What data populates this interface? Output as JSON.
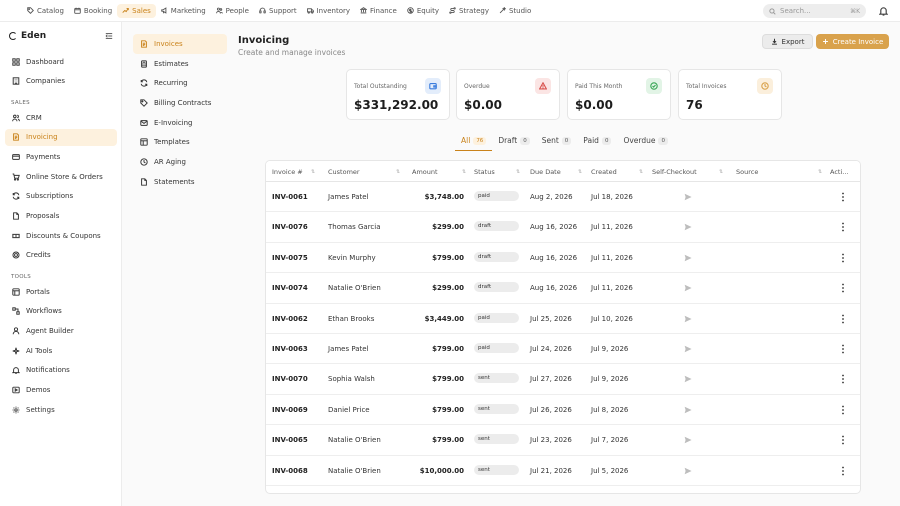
{
  "topnav": {
    "items": [
      {
        "label": "Catalog",
        "icon": "tag-icon"
      },
      {
        "label": "Booking",
        "icon": "calendar-icon"
      },
      {
        "label": "Sales",
        "icon": "trend-icon",
        "active": true
      },
      {
        "label": "Marketing",
        "icon": "megaphone-icon"
      },
      {
        "label": "People",
        "icon": "people-icon"
      },
      {
        "label": "Support",
        "icon": "headset-icon"
      },
      {
        "label": "Inventory",
        "icon": "truck-icon"
      },
      {
        "label": "Finance",
        "icon": "bank-icon"
      },
      {
        "label": "Equity",
        "icon": "dollar-circle-icon"
      },
      {
        "label": "Strategy",
        "icon": "route-icon"
      },
      {
        "label": "Studio",
        "icon": "wand-icon"
      }
    ],
    "search_placeholder": "Search...",
    "search_shortcut": "⌘K"
  },
  "sidebar": {
    "brand": "Eden",
    "items_top": [
      {
        "label": "Dashboard",
        "icon": "grid-icon"
      },
      {
        "label": "Companies",
        "icon": "building-icon"
      }
    ],
    "section_sales": "SALES",
    "items_sales": [
      {
        "label": "CRM",
        "icon": "users-icon"
      },
      {
        "label": "Invoicing",
        "icon": "invoice-icon",
        "active": true
      },
      {
        "label": "Payments",
        "icon": "card-icon"
      },
      {
        "label": "Online Store & Orders",
        "icon": "cart-icon"
      },
      {
        "label": "Subscriptions",
        "icon": "refresh-icon"
      },
      {
        "label": "Proposals",
        "icon": "document-icon"
      },
      {
        "label": "Discounts & Coupons",
        "icon": "ticket-icon"
      },
      {
        "label": "Credits",
        "icon": "coins-icon"
      }
    ],
    "section_tools": "TOOLS",
    "items_tools": [
      {
        "label": "Portals",
        "icon": "portal-icon"
      },
      {
        "label": "Workflows",
        "icon": "workflow-icon"
      },
      {
        "label": "Agent Builder",
        "icon": "agent-icon"
      },
      {
        "label": "AI Tools",
        "icon": "sparkle-icon"
      },
      {
        "label": "Notifications",
        "icon": "bell-icon"
      },
      {
        "label": "Demos",
        "icon": "play-icon"
      },
      {
        "label": "Settings",
        "icon": "gear-icon"
      }
    ]
  },
  "subnav": {
    "items": [
      {
        "label": "Invoices",
        "icon": "invoice-icon",
        "active": true
      },
      {
        "label": "Estimates",
        "icon": "calculator-icon"
      },
      {
        "label": "Recurring",
        "icon": "refresh-icon"
      },
      {
        "label": "Billing Contracts",
        "icon": "tag-icon"
      },
      {
        "label": "E-Invoicing",
        "icon": "mail-icon"
      },
      {
        "label": "Templates",
        "icon": "template-icon"
      },
      {
        "label": "AR Aging",
        "icon": "clock-icon"
      },
      {
        "label": "Statements",
        "icon": "document-icon"
      }
    ]
  },
  "header": {
    "title": "Invoicing",
    "subtitle": "Create and manage invoices",
    "export_label": "Export",
    "create_label": "Create Invoice"
  },
  "stats": [
    {
      "label": "Total Outstanding",
      "value": "$331,292.00",
      "icon": "wallet-icon",
      "color": "#3b7ddd",
      "bg": "#e3edfb"
    },
    {
      "label": "Overdue",
      "value": "$0.00",
      "icon": "alert-icon",
      "color": "#d9534f",
      "bg": "#fbe5e4"
    },
    {
      "label": "Paid This Month",
      "value": "$0.00",
      "icon": "check-circle-icon",
      "color": "#3aa757",
      "bg": "#e2f4e6"
    },
    {
      "label": "Total Invoices",
      "value": "76",
      "icon": "clock-icon",
      "color": "#d9a24c",
      "bg": "#fbefdc"
    }
  ],
  "filter_tabs": [
    {
      "label": "All",
      "count": "76",
      "active": true
    },
    {
      "label": "Draft",
      "count": "0"
    },
    {
      "label": "Sent",
      "count": "0"
    },
    {
      "label": "Paid",
      "count": "0"
    },
    {
      "label": "Overdue",
      "count": "0"
    }
  ],
  "table": {
    "columns": [
      "Invoice #",
      "Customer",
      "Amount",
      "Status",
      "Due Date",
      "Created",
      "Self-Checkout",
      "Source",
      "Acti..."
    ],
    "rows": [
      {
        "invoice": "INV-0061",
        "customer": "James Patel",
        "amount": "$3,748.00",
        "status": "paid",
        "due": "Aug 2, 2026",
        "created": "Jul 18, 2026"
      },
      {
        "invoice": "INV-0076",
        "customer": "Thomas Garcia",
        "amount": "$299.00",
        "status": "draft",
        "due": "Aug 16, 2026",
        "created": "Jul 11, 2026"
      },
      {
        "invoice": "INV-0075",
        "customer": "Kevin Murphy",
        "amount": "$799.00",
        "status": "draft",
        "due": "Aug 16, 2026",
        "created": "Jul 11, 2026"
      },
      {
        "invoice": "INV-0074",
        "customer": "Natalie O'Brien",
        "amount": "$299.00",
        "status": "draft",
        "due": "Aug 16, 2026",
        "created": "Jul 11, 2026"
      },
      {
        "invoice": "INV-0062",
        "customer": "Ethan Brooks",
        "amount": "$3,449.00",
        "status": "paid",
        "due": "Jul 25, 2026",
        "created": "Jul 10, 2026"
      },
      {
        "invoice": "INV-0063",
        "customer": "James Patel",
        "amount": "$799.00",
        "status": "paid",
        "due": "Jul 24, 2026",
        "created": "Jul 9, 2026"
      },
      {
        "invoice": "INV-0070",
        "customer": "Sophia Walsh",
        "amount": "$799.00",
        "status": "sent",
        "due": "Jul 27, 2026",
        "created": "Jul 9, 2026"
      },
      {
        "invoice": "INV-0069",
        "customer": "Daniel Price",
        "amount": "$799.00",
        "status": "sent",
        "due": "Jul 26, 2026",
        "created": "Jul 8, 2026"
      },
      {
        "invoice": "INV-0065",
        "customer": "Natalie O'Brien",
        "amount": "$799.00",
        "status": "sent",
        "due": "Jul 23, 2026",
        "created": "Jul 7, 2026"
      },
      {
        "invoice": "INV-0068",
        "customer": "Natalie O'Brien",
        "amount": "$10,000.00",
        "status": "sent",
        "due": "Jul 21, 2026",
        "created": "Jul 5, 2026"
      }
    ]
  }
}
